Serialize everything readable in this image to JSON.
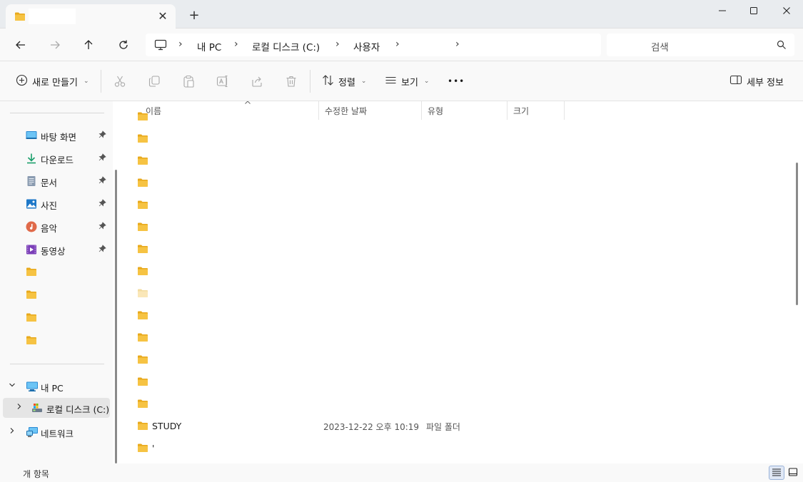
{
  "window": {
    "tab_close": "✕",
    "new_tab": "+"
  },
  "address_bar": {
    "crumbs": [
      "내 PC",
      "로컬 디스크 (C:)",
      "사용자"
    ],
    "separator": "›"
  },
  "search": {
    "placeholder": "검색"
  },
  "command_bar": {
    "new_label": "새로 만들기",
    "sort_label": "정렬",
    "view_label": "보기",
    "more_label": "•••",
    "details_label": "세부 정보",
    "dropdown_glyph": "⌄"
  },
  "nav_pane": {
    "quick_access": [
      {
        "label": "바탕 화면",
        "icon": "desktop-icon"
      },
      {
        "label": "다운로드",
        "icon": "download-icon"
      },
      {
        "label": "문서",
        "icon": "documents-icon"
      },
      {
        "label": "사진",
        "icon": "pictures-icon"
      },
      {
        "label": "음악",
        "icon": "music-icon"
      },
      {
        "label": "동영상",
        "icon": "videos-icon"
      }
    ],
    "this_pc": "내 PC",
    "local_disk": "로컬 디스크 (C:)",
    "network": "네트워크"
  },
  "columns": {
    "name": "이름",
    "date": "수정한 날짜",
    "type": "유형",
    "size": "크기"
  },
  "files": [
    {
      "name": "",
      "date": "",
      "type": ""
    },
    {
      "name": "",
      "date": "",
      "type": ""
    },
    {
      "name": "",
      "date": "",
      "type": ""
    },
    {
      "name": "",
      "date": "",
      "type": ""
    },
    {
      "name": "",
      "date": "",
      "type": ""
    },
    {
      "name": "",
      "date": "",
      "type": ""
    },
    {
      "name": "",
      "date": "",
      "type": ""
    },
    {
      "name": "",
      "date": "",
      "type": ""
    },
    {
      "name": "",
      "date": "",
      "type": "",
      "faded": true
    },
    {
      "name": "",
      "date": "",
      "type": ""
    },
    {
      "name": "",
      "date": "",
      "type": ""
    },
    {
      "name": "",
      "date": "",
      "type": ""
    },
    {
      "name": "",
      "date": "",
      "type": ""
    },
    {
      "name": "",
      "date": "",
      "type": ""
    },
    {
      "name": "STUDY",
      "date": "2023-12-22 오후 10:19",
      "type": "파일 폴더"
    },
    {
      "name": "'",
      "date": "",
      "type": ""
    }
  ],
  "status": {
    "count_text": "개 항목"
  },
  "colors": {
    "folder": "#f6c343",
    "folder_dark": "#e8a91c",
    "accent": "#0067c0"
  }
}
